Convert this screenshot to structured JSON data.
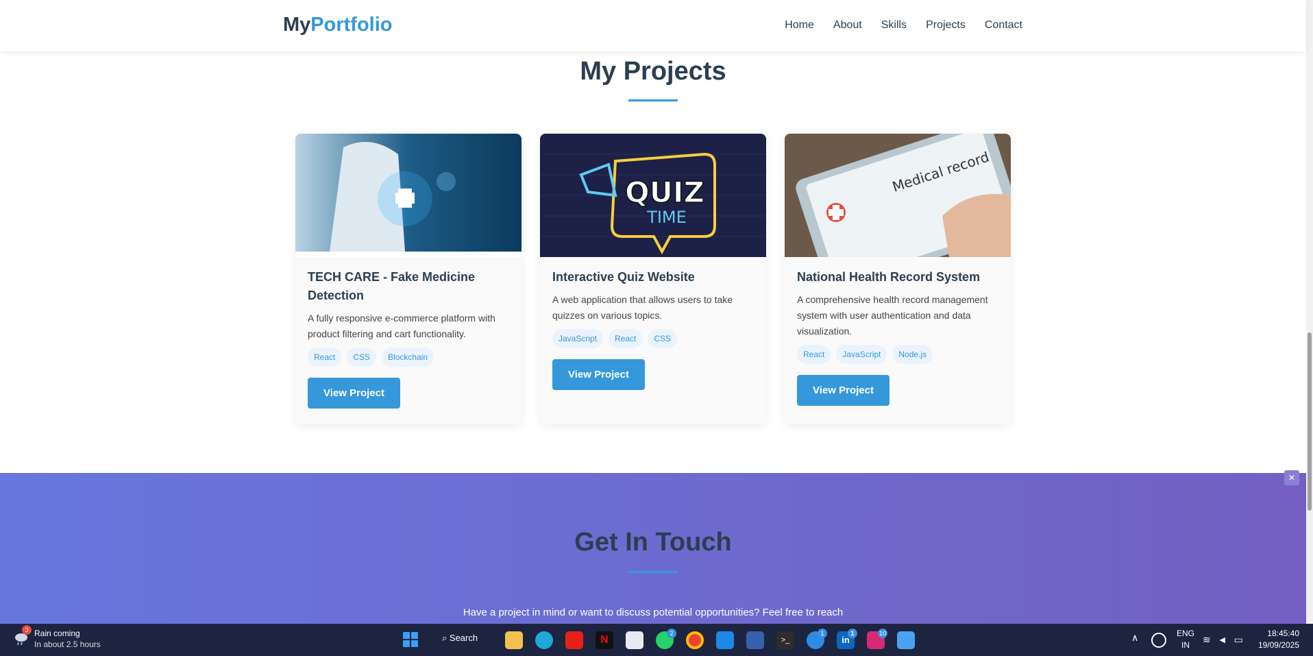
{
  "nav": {
    "logo_part1": "My",
    "logo_part2": "Portfolio",
    "links": [
      "Home",
      "About",
      "Skills",
      "Projects",
      "Contact"
    ]
  },
  "projects": {
    "title": "My Projects",
    "cards": [
      {
        "title": "TECH CARE - Fake Medicine Detection",
        "description": "A fully responsive e-commerce platform with product filtering and cart functionality.",
        "tags": [
          "React",
          "CSS",
          "Blockchain"
        ],
        "button": "View Project"
      },
      {
        "title": "Interactive Quiz Website",
        "description": "A web application that allows users to take quizzes on various topics.",
        "tags": [
          "JavaScript",
          "React",
          "CSS"
        ],
        "button": "View Project"
      },
      {
        "title": "National Health Record System",
        "description": "A comprehensive health record management system with user authentication and data visualization.",
        "tags": [
          "React",
          "JavaScript",
          "Node.js"
        ],
        "button": "View Project"
      }
    ],
    "quiz_image_text": [
      "QUIZ",
      "TIME"
    ],
    "health_image_text": "Medical record"
  },
  "contact": {
    "title": "Get In Touch",
    "text": "Have a project in mind or want to discuss potential opportunities? Feel free to reach"
  },
  "taskbar": {
    "weather_line1": "Rain coming",
    "weather_line2": "In about 2.5 hours",
    "weather_badge": "3",
    "search": "Search",
    "lang1": "ENG",
    "lang2": "IN",
    "time": "18:45:40",
    "date": "19/09/2025",
    "badges": {
      "whatsapp": "2",
      "copilot": "1",
      "linkedin": "1",
      "instagram": "10"
    }
  },
  "colors": {
    "accent": "#3498db",
    "heading": "#2c3e50",
    "contact_gradient_start": "#6776dd",
    "contact_gradient_end": "#7360c2",
    "taskbar": "#1c2440"
  }
}
